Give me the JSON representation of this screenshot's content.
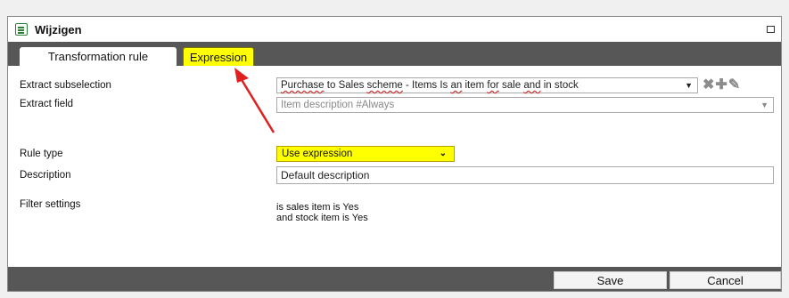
{
  "window": {
    "title": "Wijzigen",
    "icon": "form-icon",
    "maximize_icon": "maximize-icon"
  },
  "tabs": [
    {
      "label": "Transformation rule",
      "active": true
    },
    {
      "label": "Expression",
      "highlight_color": "#ffff00"
    }
  ],
  "form": {
    "extract_subselection": {
      "label": "Extract subselection",
      "value": "Purchase to Sales scheme - Items Is an item for sale and in stock"
    },
    "extract_field": {
      "label": "Extract field",
      "placeholder": "Item description #Always"
    },
    "rule_type": {
      "label": "Rule type",
      "value": "Use expression",
      "highlight_color": "#ffff00"
    },
    "description": {
      "label": "Description",
      "value": "Default description"
    },
    "filter_settings": {
      "label": "Filter settings",
      "line1": "is sales item is Yes",
      "line2": "and stock item is Yes"
    }
  },
  "toolbar_icons": [
    "delete-x-icon",
    "add-plus-icon",
    "edit-pencil-icon"
  ],
  "footer": {
    "save_label": "Save",
    "cancel_label": "Cancel"
  },
  "annotation": {
    "arrow_color": "#e02020"
  }
}
